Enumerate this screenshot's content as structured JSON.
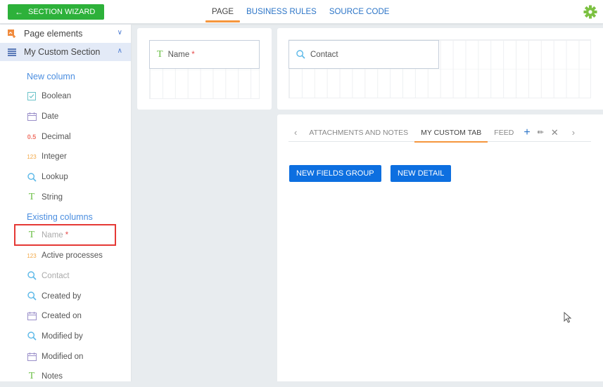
{
  "header": {
    "back_button_label": "SECTION WIZARD",
    "tabs": [
      {
        "label": "PAGE",
        "active": true
      },
      {
        "label": "BUSINESS RULES",
        "active": false
      },
      {
        "label": "SOURCE CODE",
        "active": false
      }
    ],
    "settings_icon": "gear-icon"
  },
  "sidebar": {
    "page_elements_label": "Page elements",
    "section_label": "My Custom Section",
    "new_column_label": "New column",
    "new_columns": [
      {
        "label": "Boolean",
        "icon": "checkbox-icon"
      },
      {
        "label": "Date",
        "icon": "calendar-icon"
      },
      {
        "label": "Decimal",
        "icon": "decimal-icon",
        "glyph": "0.5"
      },
      {
        "label": "Integer",
        "icon": "integer-icon",
        "glyph": "123"
      },
      {
        "label": "Lookup",
        "icon": "search-icon"
      },
      {
        "label": "String",
        "icon": "text-icon",
        "glyph": "T"
      }
    ],
    "existing_columns_label": "Existing columns",
    "existing_columns": [
      {
        "label": "Name",
        "icon": "text-icon",
        "glyph": "T",
        "required": "*",
        "disabled": true,
        "highlighted": true
      },
      {
        "label": "Active processes",
        "icon": "integer-icon",
        "glyph": "123"
      },
      {
        "label": "Contact",
        "icon": "search-icon",
        "disabled": true
      },
      {
        "label": "Created by",
        "icon": "search-icon"
      },
      {
        "label": "Created on",
        "icon": "calendar-icon"
      },
      {
        "label": "Modified by",
        "icon": "search-icon"
      },
      {
        "label": "Modified on",
        "icon": "calendar-icon"
      },
      {
        "label": "Notes",
        "icon": "text-icon",
        "glyph": "T"
      }
    ]
  },
  "canvas": {
    "primary_field": {
      "label": "Name",
      "required": "*",
      "glyph": "T"
    },
    "header_field": {
      "label": "Contact"
    },
    "detail_tabs": [
      {
        "label": "ATTACHMENTS AND NOTES",
        "active": false
      },
      {
        "label": "MY CUSTOM TAB",
        "active": true
      },
      {
        "label": "FEED",
        "active": false
      }
    ],
    "new_fields_group_label": "NEW FIELDS GROUP",
    "new_detail_label": "NEW DETAIL"
  },
  "colors": {
    "wizard_green": "#2db13a",
    "accent_orange": "#f5963d",
    "link_blue": "#2b74c7",
    "button_blue": "#0d6fe0",
    "required_red": "#e64d4d"
  }
}
